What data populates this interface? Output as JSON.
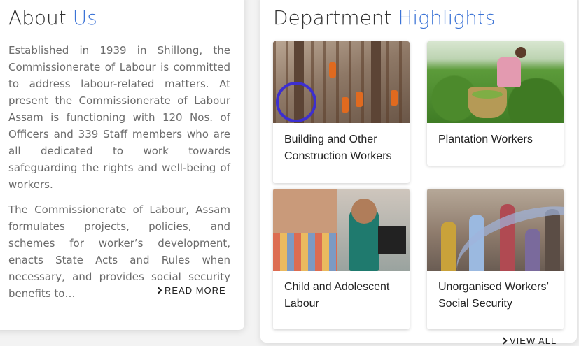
{
  "about": {
    "title_plain": "About",
    "title_accent": "Us",
    "paragraphs": [
      "Established in 1939 in Shillong, the Commissionerate of Labour is committed to address labour-related matters. At present the Commissionerate of Labour Assam is functioning with 120 Nos. of Officers and 339 Staff members who are all dedicated to work towards safeguarding the rights and well-being of workers.",
      "The Commissionerate of Labour, Assam for­mulates projects, policies, and schemes for worker’s development, enacts State Acts and Rules when necessary, and provides social security benefits to…"
    ],
    "read_more_label": "READ MORE"
  },
  "department": {
    "title_plain": "Department",
    "title_accent": "Highlights",
    "tiles": [
      {
        "label": "Building and Other Construction Workers"
      },
      {
        "label": "Plantation Workers"
      },
      {
        "label": "Child and Adolescent Labour"
      },
      {
        "label": "Unorganised Workers’ Social Security"
      }
    ],
    "view_all_label": "VIEW ALL"
  },
  "colors": {
    "accent": "#3b73d6",
    "text": "#333333",
    "body_text": "#6b6b6b"
  }
}
